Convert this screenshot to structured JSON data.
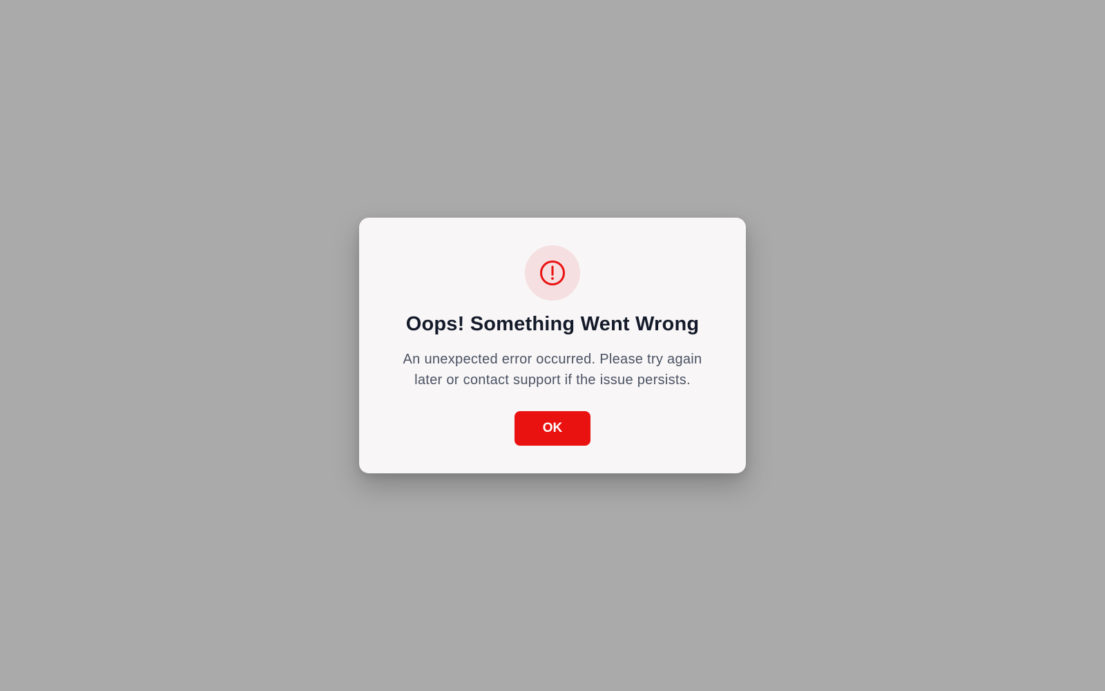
{
  "dialog": {
    "icon": "exclamation-circle-icon",
    "title": "Oops! Something Went Wrong",
    "message": "An unexpected error occurred. Please try again later or contact support if the issue persists.",
    "ok_label": "OK"
  },
  "colors": {
    "backdrop": "#aaaaaa",
    "dialog_background": "#f8f6f7",
    "accent": "#ea1111",
    "icon_background": "#f5dfe0",
    "title": "#141a29",
    "message": "#4a5262"
  }
}
